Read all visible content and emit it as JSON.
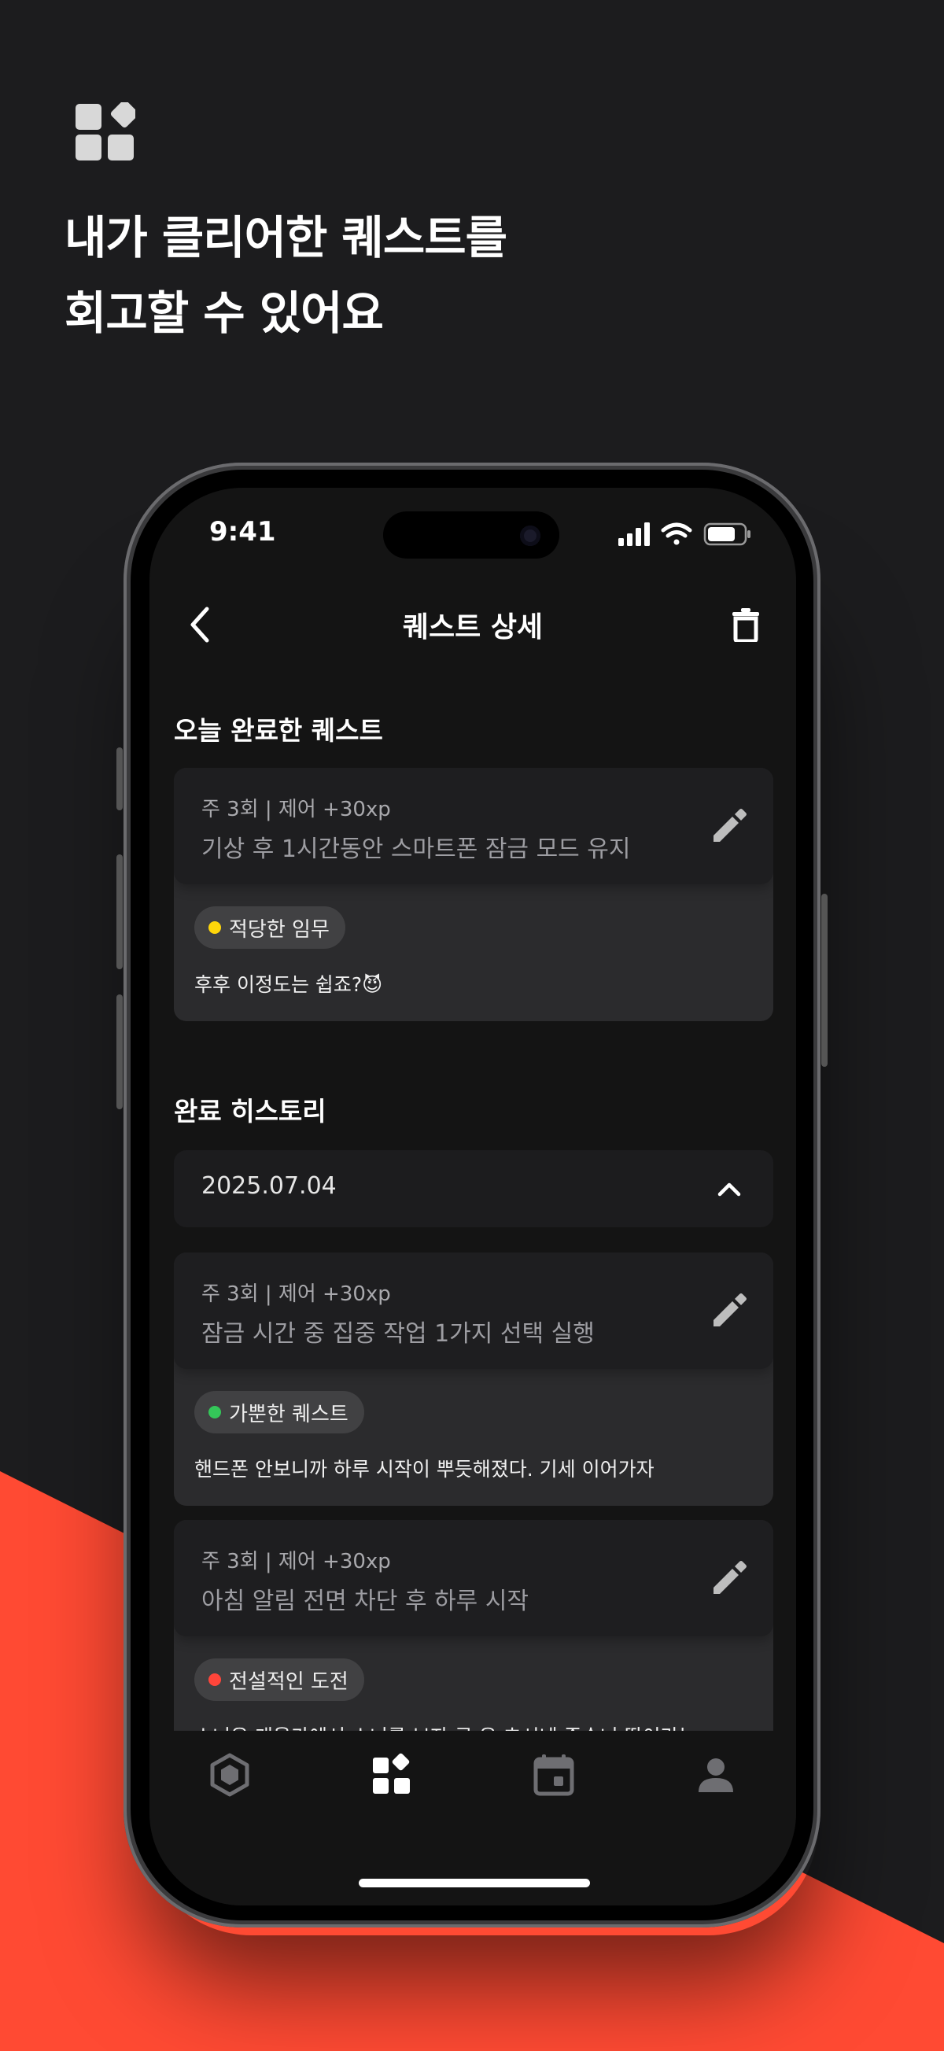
{
  "promo": {
    "headline_line1": "내가 클리어한 퀘스트를",
    "headline_line2": "회고할 수 있어요",
    "logo_icon": "app-grid-diamond-icon"
  },
  "status_bar": {
    "time": "9:41",
    "icons": [
      "signal-icon",
      "wifi-icon",
      "battery-icon"
    ]
  },
  "nav": {
    "title": "퀘스트 상세",
    "back_icon": "chevron-left-icon",
    "delete_icon": "trash-icon"
  },
  "today": {
    "section_title": "오늘 완료한 퀘스트",
    "card": {
      "meta": "주 3회 | 제어 +30xp",
      "title": "기상 후 1시간동안 스마트폰 잠금 모드 유지",
      "badge": "적당한 임무",
      "badge_color": "#ffd60a",
      "note": "후후 이정도는 쉽죠?😈"
    }
  },
  "history": {
    "section_title": "완료 히스토리",
    "date": "2025.07.04",
    "cards": [
      {
        "meta": "주 3회 | 제어 +30xp",
        "title": "잠금 시간 중 집중 작업 1가지 선택 실행",
        "badge": "가뿐한 퀘스트",
        "badge_color": "#34c759",
        "note": "핸드폰 안보니까 하루 시작이 뿌듯해졌다. 기세 이어가자"
      },
      {
        "meta": "주 3회 | 제어 +30xp",
        "title": "아침 알림 전면 차단 후 하루 시작",
        "badge": "전설적인 도전",
        "badge_color": "#ff453a",
        "note": "소녀은 개울가에서 소녀를 보자 곧 윤 초시네 증손녀 딸이라는"
      }
    ]
  },
  "tabbar": {
    "tabs": [
      "hexagon-icon",
      "grid-icon",
      "calendar-icon",
      "profile-icon"
    ],
    "active_index": 1
  },
  "colors": {
    "background": "#1c1c1e",
    "accent_red": "#ff4a33"
  }
}
